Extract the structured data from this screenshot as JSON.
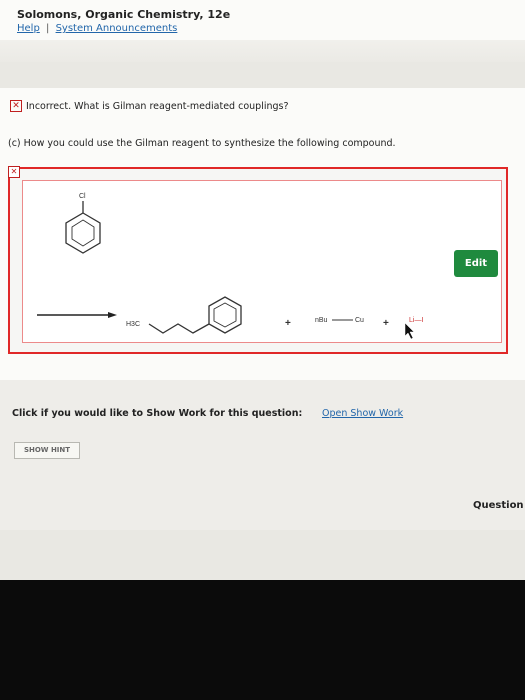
{
  "header": {
    "book_title": "Solomons, Organic Chemistry, 12e",
    "help_link": "Help",
    "separator": "|",
    "announcements_link": "System Announcements"
  },
  "status": {
    "icon": "x-icon",
    "message": "Incorrect. What is Gilman reagent-mediated couplings?"
  },
  "question": {
    "text": "(c) How you could use the Gilman reagent to synthesize the following compound."
  },
  "structure": {
    "cl_label": "Cl",
    "h3c_label": "H3C",
    "plus_1": "+",
    "nbu_label": "nBu",
    "cu_label": "Cu",
    "plus_2": "+",
    "li_label": "Li—I"
  },
  "edit_button": "Edit",
  "show_work": {
    "prompt": "Click if you would like to Show Work for this question:",
    "link": "Open Show Work"
  },
  "hint_button": "SHOW HINT",
  "question_nav": "Question",
  "colors": {
    "error_red": "#e02828",
    "edit_green": "#1f8a3e",
    "link_blue": "#2266aa"
  }
}
